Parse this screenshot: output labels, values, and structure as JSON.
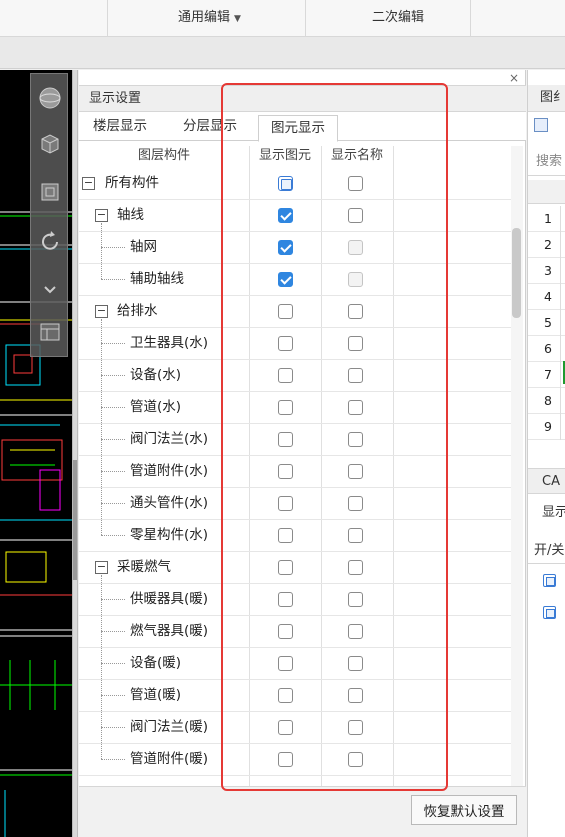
{
  "ribbon": {
    "tab_general_edit": "通用编辑",
    "tab_secondary_edit": "二次编辑"
  },
  "panel": {
    "title": "显示设置",
    "close_label": "×",
    "tabs": [
      "楼层显示",
      "分层显示",
      "图元显示"
    ],
    "active_tab": "图元显示",
    "columns": {
      "layer_component": "图层构件",
      "show_element": "显示图元",
      "show_name": "显示名称"
    },
    "rows": [
      {
        "label": "所有构件",
        "level": 0,
        "toggle": "−",
        "show_element": "partial",
        "show_name": "unchecked"
      },
      {
        "label": "轴线",
        "level": 1,
        "toggle": "−",
        "show_element": "checked",
        "show_name": "unchecked"
      },
      {
        "label": "轴网",
        "level": 2,
        "show_element": "checked",
        "show_name": "disabled"
      },
      {
        "label": "辅助轴线",
        "level": 2,
        "show_element": "checked",
        "show_name": "disabled"
      },
      {
        "label": "给排水",
        "level": 1,
        "toggle": "−",
        "show_element": "unchecked",
        "show_name": "unchecked"
      },
      {
        "label": "卫生器具(水)",
        "level": 2,
        "show_element": "unchecked",
        "show_name": "unchecked"
      },
      {
        "label": "设备(水)",
        "level": 2,
        "show_element": "unchecked",
        "show_name": "unchecked"
      },
      {
        "label": "管道(水)",
        "level": 2,
        "show_element": "unchecked",
        "show_name": "unchecked"
      },
      {
        "label": "阀门法兰(水)",
        "level": 2,
        "show_element": "unchecked",
        "show_name": "unchecked"
      },
      {
        "label": "管道附件(水)",
        "level": 2,
        "show_element": "unchecked",
        "show_name": "unchecked"
      },
      {
        "label": "通头管件(水)",
        "level": 2,
        "show_element": "unchecked",
        "show_name": "unchecked"
      },
      {
        "label": "零星构件(水)",
        "level": 2,
        "show_element": "unchecked",
        "show_name": "unchecked"
      },
      {
        "label": "采暖燃气",
        "level": 1,
        "toggle": "−",
        "show_element": "unchecked",
        "show_name": "unchecked"
      },
      {
        "label": "供暖器具(暖)",
        "level": 2,
        "show_element": "unchecked",
        "show_name": "unchecked"
      },
      {
        "label": "燃气器具(暖)",
        "level": 2,
        "show_element": "unchecked",
        "show_name": "unchecked"
      },
      {
        "label": "设备(暖)",
        "level": 2,
        "show_element": "unchecked",
        "show_name": "unchecked"
      },
      {
        "label": "管道(暖)",
        "level": 2,
        "show_element": "unchecked",
        "show_name": "unchecked"
      },
      {
        "label": "阀门法兰(暖)",
        "level": 2,
        "show_element": "unchecked",
        "show_name": "unchecked"
      },
      {
        "label": "管道附件(暖)",
        "level": 2,
        "show_element": "unchecked",
        "show_name": "unchecked"
      }
    ],
    "restore_button": "恢复默认设置"
  },
  "right_panel": {
    "title_fragment": "图纟",
    "search_fragment": "搜索",
    "row_numbers": [
      "1",
      "2",
      "3",
      "4",
      "5",
      "6",
      "7",
      "8",
      "9"
    ],
    "cad_label": "CA",
    "display_fragment": "显示",
    "switch_fragment": "开/关"
  },
  "colors": {
    "highlight_box": "#e53935",
    "checkbox_checked": "#2f86e0",
    "row_active_marker": "#1f9a2f"
  }
}
